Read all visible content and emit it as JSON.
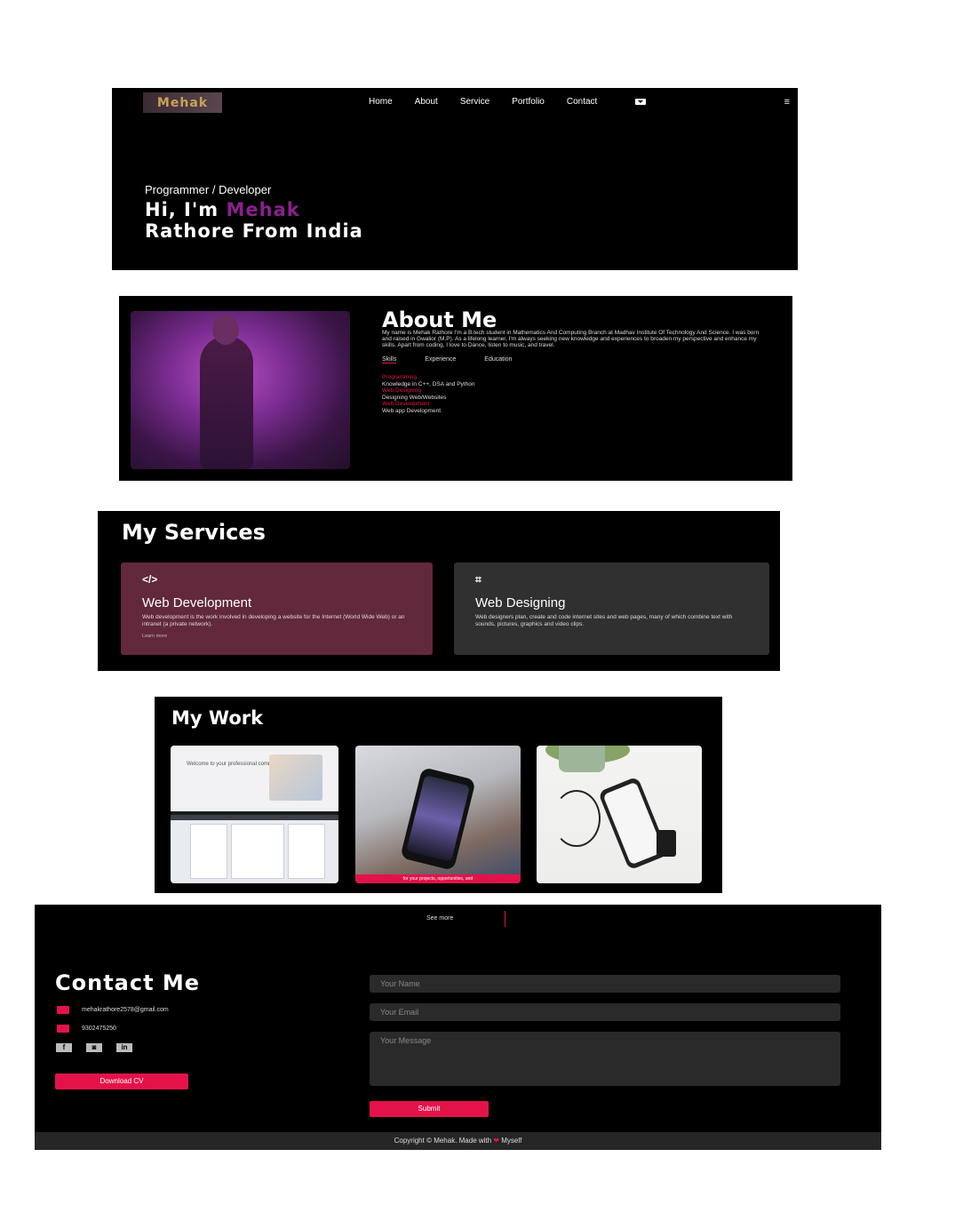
{
  "colors": {
    "accent": "#e3134a",
    "highlight": "#8b1f8e",
    "panel": "#000000",
    "card1": "#62283b",
    "card2": "#303030"
  },
  "header": {
    "logo": "Mehak",
    "nav": [
      "Home",
      "About",
      "Service",
      "Portfolio",
      "Contact"
    ],
    "menu_icon": "≡"
  },
  "hero": {
    "subtitle": "Programmer / Developer",
    "line1_prefix": "Hi, I'm ",
    "line1_name": "Mehak",
    "line2": "Rathore From India"
  },
  "about": {
    "title": "About Me",
    "paragraph": "My name is Mehak Rathore I'm a B.tech student in Mathematics And Computing Branch at Madhav Institute Of Technology And Science. I was born and raised in Gwalior (M.P). As a lifelong learner, I'm always seeking new knowledge and experiences to broaden my perspective and enhance my skills. Apart from coding, I love to Dance, listen to music, and travel.",
    "tabs": [
      "Skills",
      "Experience",
      "Education"
    ],
    "skills": [
      {
        "title": "Programming",
        "desc": "Knowledge in C++, DSA and Python"
      },
      {
        "title": "Web Designing",
        "desc": "Designing Web/Websites"
      },
      {
        "title": "Web Development",
        "desc": "Web app Development"
      }
    ]
  },
  "services": {
    "title": "My Services",
    "cards": [
      {
        "icon": "</>",
        "title": "Web Development",
        "desc": "Web development is the work involved in developing a website for the Internet (World Wide Web) or an intranet (a private network).",
        "link": "Learn more"
      },
      {
        "icon": "⌗",
        "title": "Web Designing",
        "desc": "Web designers plan, create and code internet sites and web pages, many of which combine text with sounds, pictures, graphics and video clips.",
        "link": ""
      }
    ]
  },
  "work": {
    "title": "My Work",
    "thumb1_text": "Welcome to your professional community",
    "thumb2_caption": "for your projects, opportunities, and"
  },
  "contact": {
    "see_more": "See more",
    "title": "Contact Me",
    "email": "mehakrathore2578@gmail.com",
    "phone": "9302475250",
    "socials": [
      "f",
      "◙",
      "in"
    ],
    "download_cv": "Download CV",
    "form": {
      "name_placeholder": "Your Name",
      "email_placeholder": "Your Email",
      "message_placeholder": "Your Message",
      "submit": "Submit"
    },
    "footer_prefix": "Copyright © Mehak. Made with ",
    "footer_heart": "❤",
    "footer_suffix": " Myself"
  }
}
